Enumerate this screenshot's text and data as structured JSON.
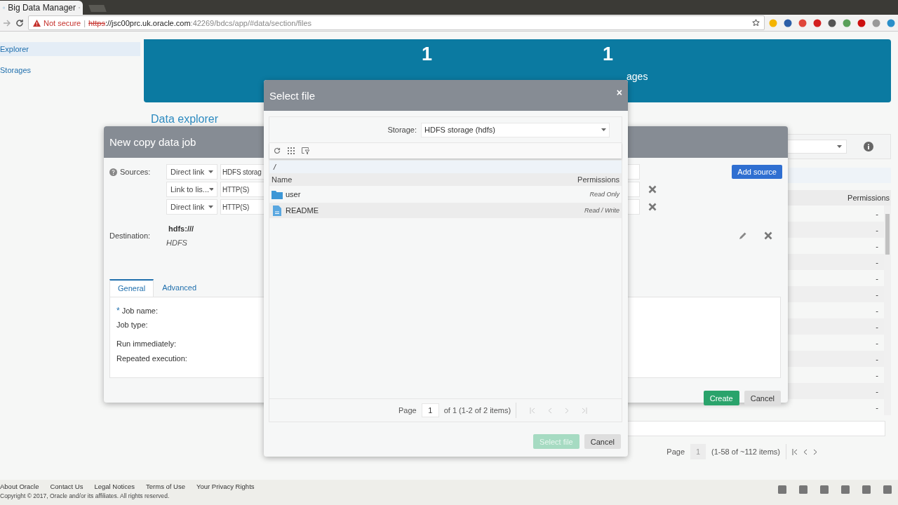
{
  "browser": {
    "tab_title": "Big Data Manager",
    "url": {
      "warning": "Not secure",
      "separator": "|",
      "scheme": "https",
      "host": "://jsc00prc.uk.oracle.com",
      "path": ":42269/bdcs/app/#data/section/files"
    }
  },
  "sidebar": {
    "items": [
      {
        "label": "Explorer",
        "selected": true
      },
      {
        "label": "Storages",
        "selected": false
      }
    ]
  },
  "banner": {
    "stats": [
      {
        "value": "1"
      },
      {
        "value": "1",
        "label": "ages"
      }
    ]
  },
  "heading": "Data explorer",
  "file_panel": {
    "permissions_header": "Permissions",
    "rows": [
      "-",
      "-",
      "-",
      "-",
      "-",
      "-",
      "-",
      "-",
      "-",
      "-",
      "-",
      "-",
      "-"
    ],
    "pager": {
      "page_label": "Page",
      "page": "1",
      "summary": "(1-58 of ~112 items)"
    }
  },
  "copy_dialog": {
    "title": "New copy data job",
    "sources_label": "Sources:",
    "add_source": "Add source",
    "sources": [
      {
        "type": "Direct link",
        "storage": "HDFS storag"
      },
      {
        "type": "Link to lis...",
        "storage": "HTTP(S)"
      },
      {
        "type": "Direct link",
        "storage": "HTTP(S)"
      }
    ],
    "destination_label": "Destination:",
    "destination": {
      "path": "hdfs:///",
      "type": "HDFS"
    },
    "tabs": [
      {
        "label": "General",
        "selected": true
      },
      {
        "label": "Advanced",
        "selected": false
      }
    ],
    "required_mark": "*",
    "fields": [
      {
        "label": "Job name:",
        "required": true
      },
      {
        "label": "Job type:",
        "required": false
      },
      {
        "label": "Run immediately:",
        "required": false
      },
      {
        "label": "Repeated execution:",
        "required": false
      }
    ],
    "buttons": [
      {
        "label": "Create",
        "kind": "primary"
      },
      {
        "label": "Cancel",
        "kind": "secondary"
      }
    ]
  },
  "select_dialog": {
    "title": "Select file",
    "close": "×",
    "storage_label": "Storage:",
    "storage_value": "HDFS storage (hdfs)",
    "path": "/",
    "columns": [
      "Name",
      "Permissions"
    ],
    "rows": [
      {
        "name": "user",
        "kind": "folder",
        "permissions": "Read Only"
      },
      {
        "name": "README",
        "kind": "file",
        "permissions": "Read / Write"
      }
    ],
    "pager": {
      "page_label": "Page",
      "page": "1",
      "summary": "of 1 (1-2 of 2 items)"
    },
    "buttons": [
      {
        "label": "Select file",
        "kind": "primary",
        "disabled": true
      },
      {
        "label": "Cancel",
        "kind": "secondary",
        "disabled": false
      }
    ]
  },
  "footer": {
    "links": [
      "About Oracle",
      "Contact Us",
      "Legal Notices",
      "Terms of Use",
      "Your Privacy Rights"
    ],
    "copyright": "Copyright © 2017, Oracle and/or its affiliates. All rights reserved."
  }
}
